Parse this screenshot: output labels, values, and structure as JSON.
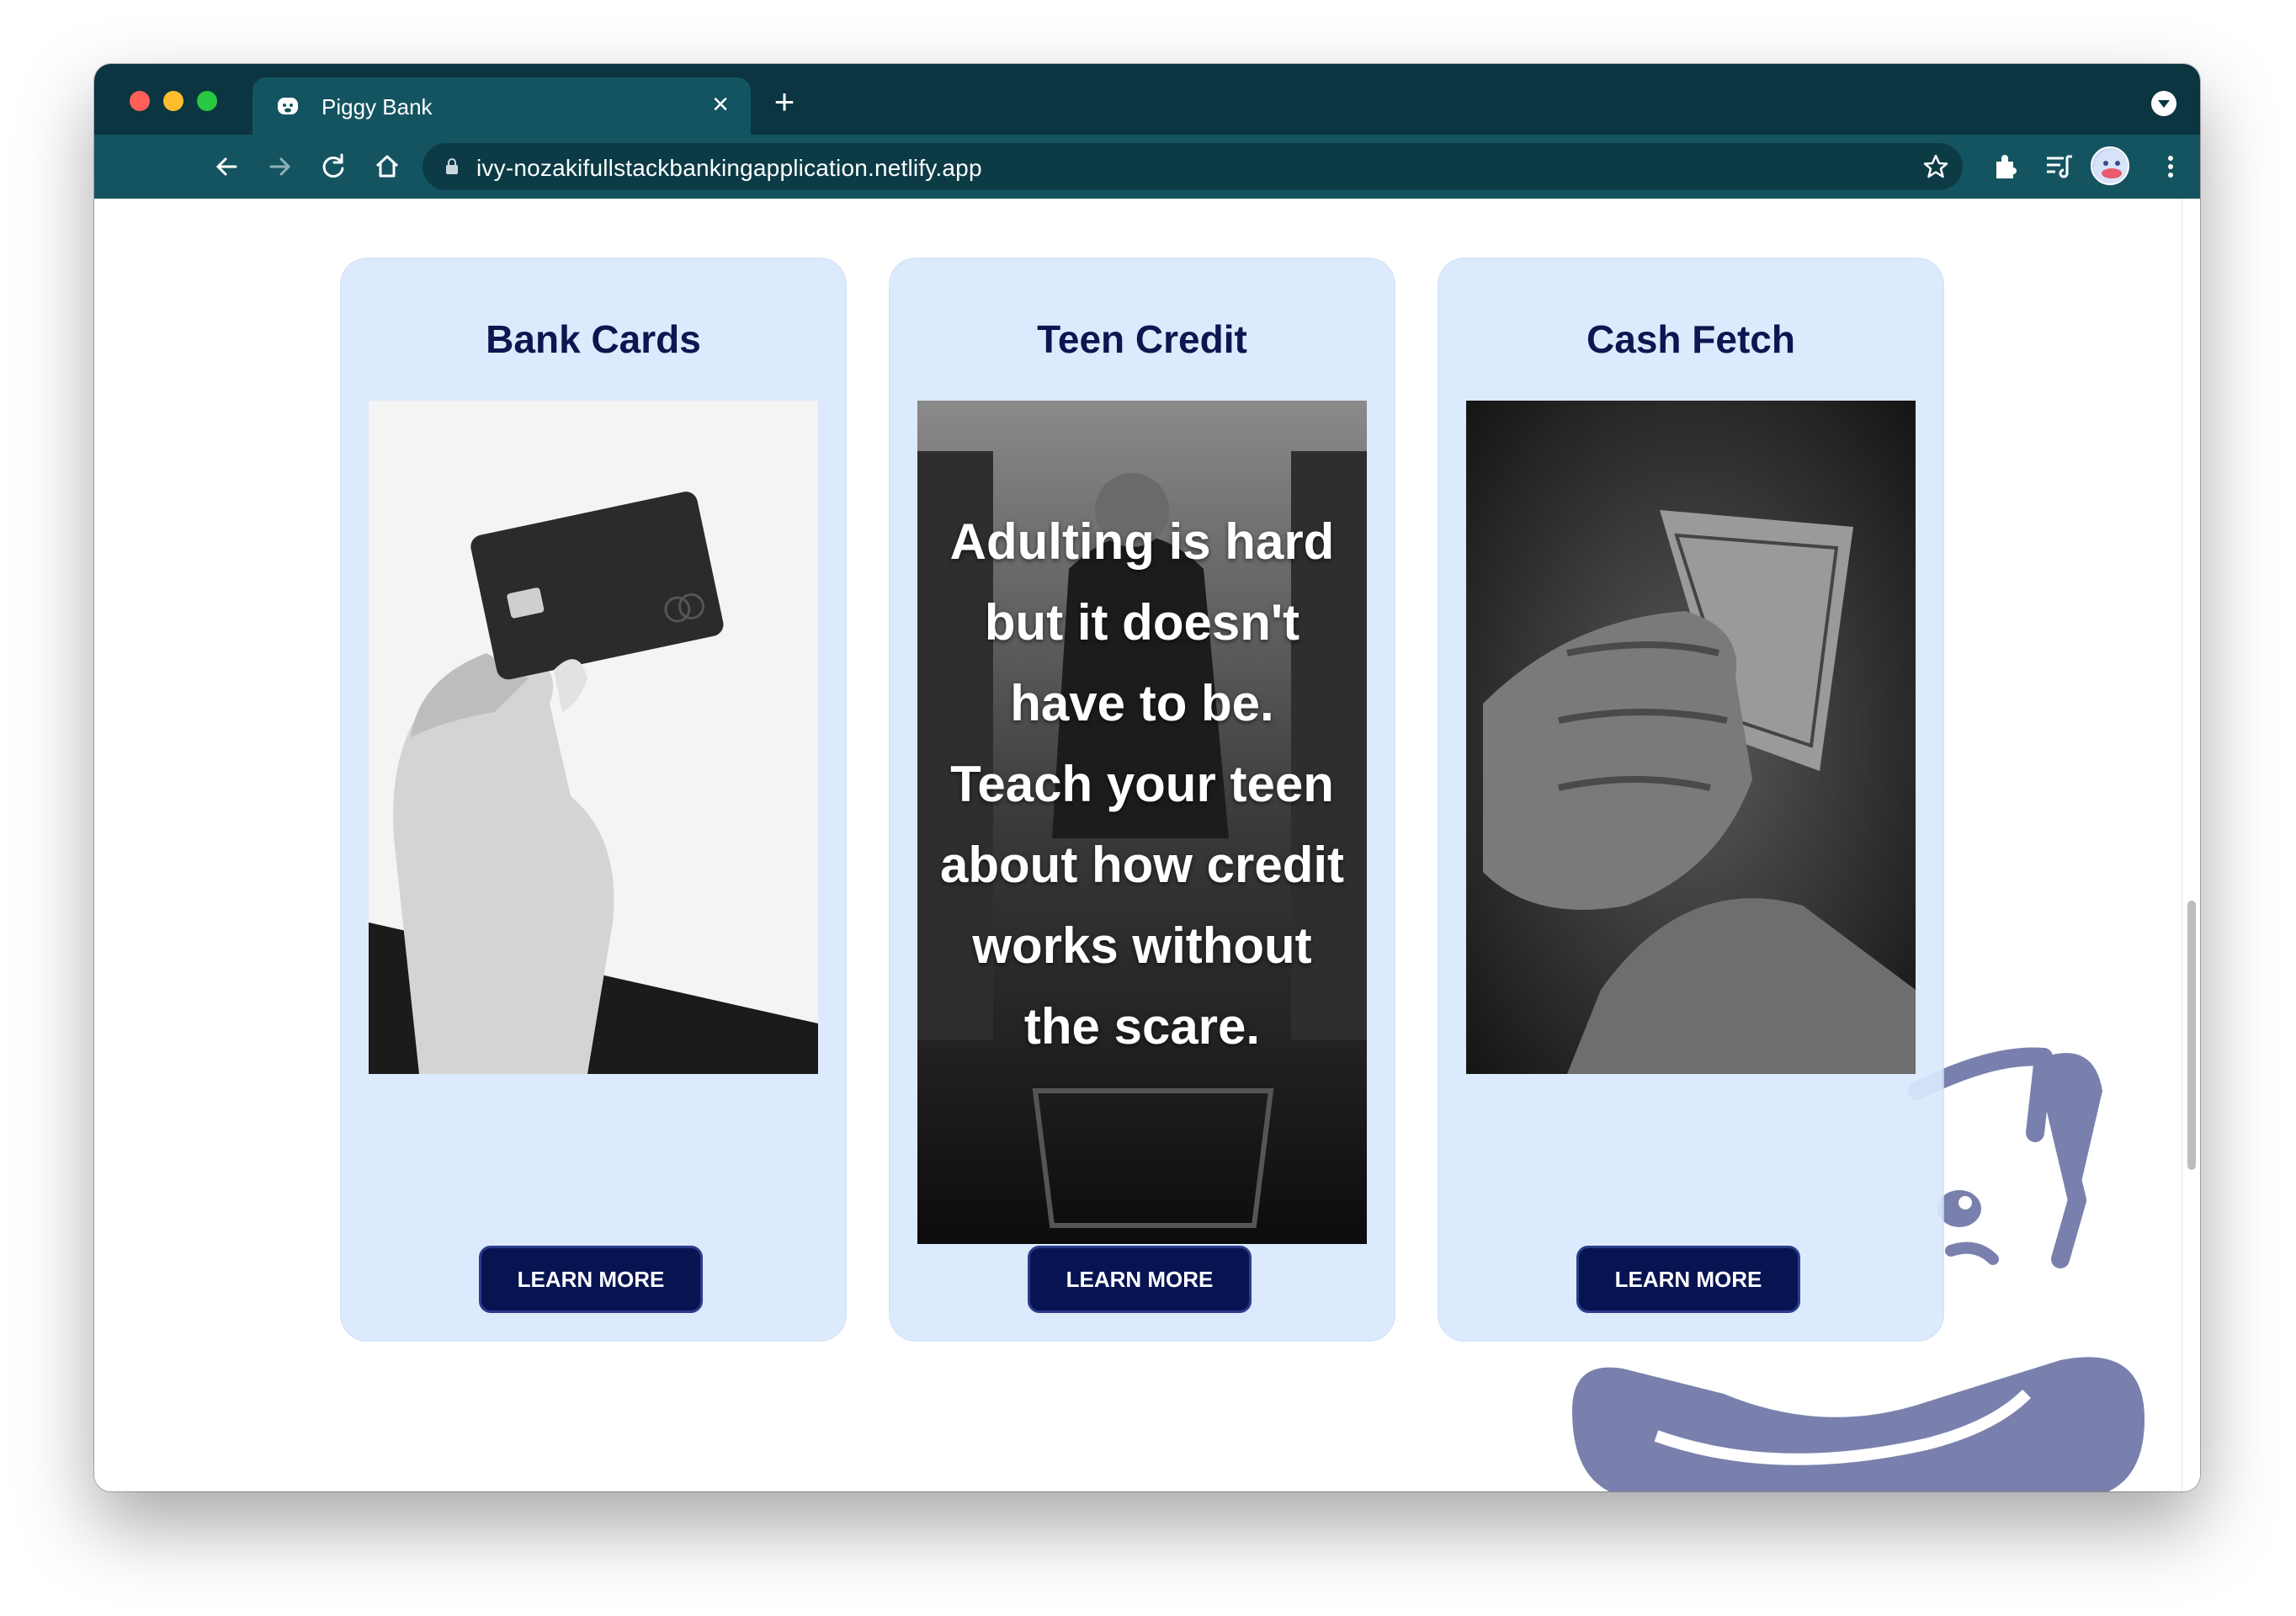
{
  "browser": {
    "tab_title": "Piggy Bank",
    "url": "ivy-nozakifullstackbankingapplication.netlify.app"
  },
  "cards": [
    {
      "title": "Bank Cards",
      "button_label": "LEARN MORE"
    },
    {
      "title": "Teen Credit",
      "overlay_text": "Adulting is hard but it doesn't have to be. Teach your teen about how credit works without the scare.",
      "button_label": "LEARN MORE"
    },
    {
      "title": "Cash Fetch",
      "button_label": "LEARN MORE"
    }
  ],
  "colors": {
    "chrome_dark": "#0b3540",
    "chrome_toolbar": "#145461",
    "card_bg": "#d9e8fd",
    "title_navy": "#0c1650",
    "button_navy": "#081452",
    "pig_purple": "#7a80ad"
  },
  "icons": [
    "piggy-favicon-icon",
    "back-icon",
    "forward-icon",
    "reload-icon",
    "home-icon",
    "lock-icon",
    "bookmark-star-icon",
    "extensions-icon",
    "reading-list-icon",
    "profile-avatar",
    "kebab-menu-icon",
    "pig-mascot-illustration"
  ]
}
